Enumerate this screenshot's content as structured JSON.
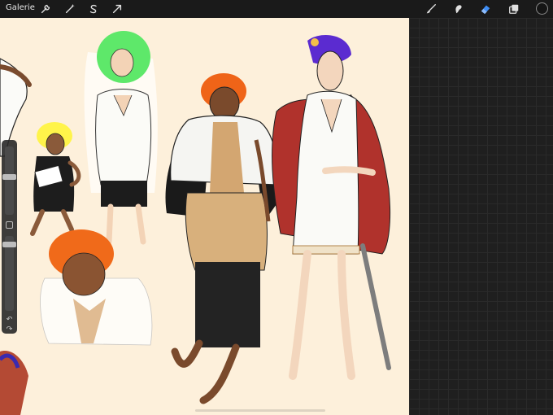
{
  "toolbar": {
    "gallery_label": "Galerie",
    "left_tools": [
      "wrench-icon",
      "magic-wand-icon",
      "selection-s-icon",
      "transform-arrow-icon"
    ],
    "right_tools": [
      "brush-icon",
      "smudge-icon",
      "eraser-icon",
      "layers-icon"
    ],
    "active_tool": "eraser-icon",
    "active_color": "#151515",
    "accent": "#3f8ef5"
  },
  "sidebar": {
    "brush_size": 0.7,
    "brush_opacity": 0.1,
    "undo_icon": "undo-icon",
    "redo_icon": "redo-icon"
  },
  "canvas": {
    "background": "#fdf0db"
  }
}
